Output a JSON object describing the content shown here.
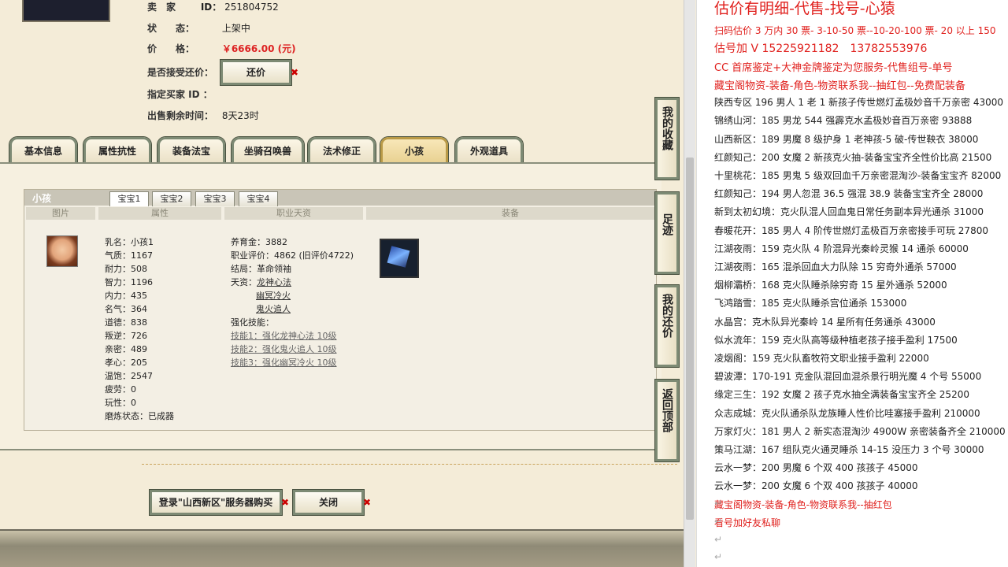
{
  "listing": {
    "seller_label": "卖　家",
    "seller_id_label": "ID：",
    "seller_id": "251804752",
    "status_label": "状　　态：",
    "status": "上架中",
    "price_label": "价　　格：",
    "price": "￥6666.00 (元)",
    "counter_label": "是否接受还价：",
    "counter_button": "还价",
    "buyer_label": "指定买家 ID ：",
    "time_label": "出售剩余时间：",
    "time_value": "8天23时"
  },
  "tabs": [
    "基本信息",
    "属性抗性",
    "装备法宝",
    "坐骑召唤兽",
    "法术修正",
    "小孩",
    "外观道具"
  ],
  "active_tab": "小孩",
  "child_panel": {
    "title": "小孩",
    "subtabs": [
      "宝宝1",
      "宝宝2",
      "宝宝3",
      "宝宝4"
    ],
    "columns": [
      "图片",
      "属性",
      "职业天资",
      "装备"
    ],
    "attrs": [
      "乳名：小孩1",
      "气质：1167",
      "耐力：508",
      "智力：1196",
      "内力：435",
      "名气：364",
      "道德：838",
      "叛逆：726",
      "亲密：489",
      "孝心：205",
      "温饱：2547",
      "疲劳：0",
      "玩性：0",
      "磨炼状态：已成器"
    ],
    "mid_lines": [
      "养育金：3882",
      "职业评价：4862 (旧评价4722)",
      "结局：革命领袖"
    ],
    "talent_label": "天资：",
    "talents": [
      "龙神心法",
      "幽冥冷火",
      "鬼火追人"
    ],
    "skills_label": "强化技能：",
    "skills": [
      "技能1：强化龙神心法 10级",
      "技能2：强化鬼火追人 10级",
      "技能3：强化幽冥冷火 10级"
    ]
  },
  "side_buttons": [
    {
      "name": "my-favorites",
      "label": "我的收藏"
    },
    {
      "name": "footprints",
      "label": "足迹"
    },
    {
      "name": "my-offers",
      "label": "我的还价"
    },
    {
      "name": "back-to-top",
      "label": "返回顶部"
    }
  ],
  "bottom_buttons": {
    "login": "登录\"山西新区\"服务器购买",
    "close": "关闭"
  },
  "right_panel": {
    "headline": "估价有明细-代售-找号-心猿",
    "lines": [
      {
        "text": "扫码估价 3 万内 30 票- 3-10-50 票--10-20-100 票- 20 以上 150",
        "style": "red"
      },
      {
        "text": "估号加 V 15225921182　13782553976",
        "style": "mid"
      },
      {
        "text": "CC 首席鉴定+大神金牌鉴定为您服务-代售组号-单号",
        "style": "red"
      },
      {
        "text": "藏宝阁物资-装备-角色-物资联系我--抽红包--免费配装备",
        "style": "red"
      },
      {
        "text": "陕西专区 196 男人 1 老 1 新孩子传世燃灯孟极妙音千万亲密 43000",
        "style": ""
      },
      {
        "text": "锦绣山河：185 男龙 544 强霹克水孟极妙音百万亲密 93888",
        "style": ""
      },
      {
        "text": "山西新区：189 男魔 8 级护身 1 老神孩-5 破-传世鞅衣 38000",
        "style": ""
      },
      {
        "text": "红颜知己：200 女魔 2 新孩克火抽-装备宝宝齐全性价比高 21500",
        "style": ""
      },
      {
        "text": "十里桃花：185 男鬼 5 级双回血千万亲密混淘沙-装备宝宝齐 82000",
        "style": ""
      },
      {
        "text": "红颜知己：194 男人忽混 36.5 强混 38.9 装备宝宝齐全 28000",
        "style": ""
      },
      {
        "text": "新到太初幻境：克火队混人回血鬼日常任务副本异光通杀 31000",
        "style": ""
      },
      {
        "text": "春暖花开：185 男人 4 阶传世燃灯孟极百万亲密接手可玩 27800",
        "style": ""
      },
      {
        "text": "江湖夜雨：159 克火队 4 阶混异光秦岭灵猴 14 通杀 60000",
        "style": ""
      },
      {
        "text": "江湖夜雨：165 混杀回血大力队除 15 穷奇外通杀 57000",
        "style": ""
      },
      {
        "text": "烟柳灞桥：168 克火队睡杀除穷奇 15 星外通杀 52000",
        "style": ""
      },
      {
        "text": "飞鸿踏雪：185 克火队睡杀宫位通杀 153000",
        "style": ""
      },
      {
        "text": "水晶宫：克木队异光秦岭 14 星所有任务通杀 43000",
        "style": ""
      },
      {
        "text": "似水流年：159 克火队高等级种植老孩子接手盈利 17500",
        "style": ""
      },
      {
        "text": "凌烟阁：159 克火队畜牧符文职业接手盈利 22000",
        "style": ""
      },
      {
        "text": "碧波潭：170-191 克金队混回血混杀景行明光魔 4 个号 55000",
        "style": ""
      },
      {
        "text": "缘定三生：192 女魔 2 孩子克水抽全满装备宝宝齐全 25200",
        "style": ""
      },
      {
        "text": "众志成城：克火队通杀队龙族睡人性价比哇塞接手盈利 210000",
        "style": ""
      },
      {
        "text": "万家灯火：181 男人 2 新实态混淘沙 4900W 亲密装备齐全 210000",
        "style": ""
      },
      {
        "text": "策马江湖：167 组队克火通灵睡杀 14-15 没压力 3 个号 30000",
        "style": ""
      },
      {
        "text": "云水一梦：200 男魔 6 个双 400 孩孩子 45000",
        "style": ""
      },
      {
        "text": "云水一梦：200 女魔 6 个双 400 孩孩子 40000",
        "style": ""
      },
      {
        "text": "藏宝阁物资-装备-角色-物资联系我--抽红包",
        "style": "red"
      },
      {
        "text": "看号加好友私聊",
        "style": "red"
      }
    ]
  }
}
